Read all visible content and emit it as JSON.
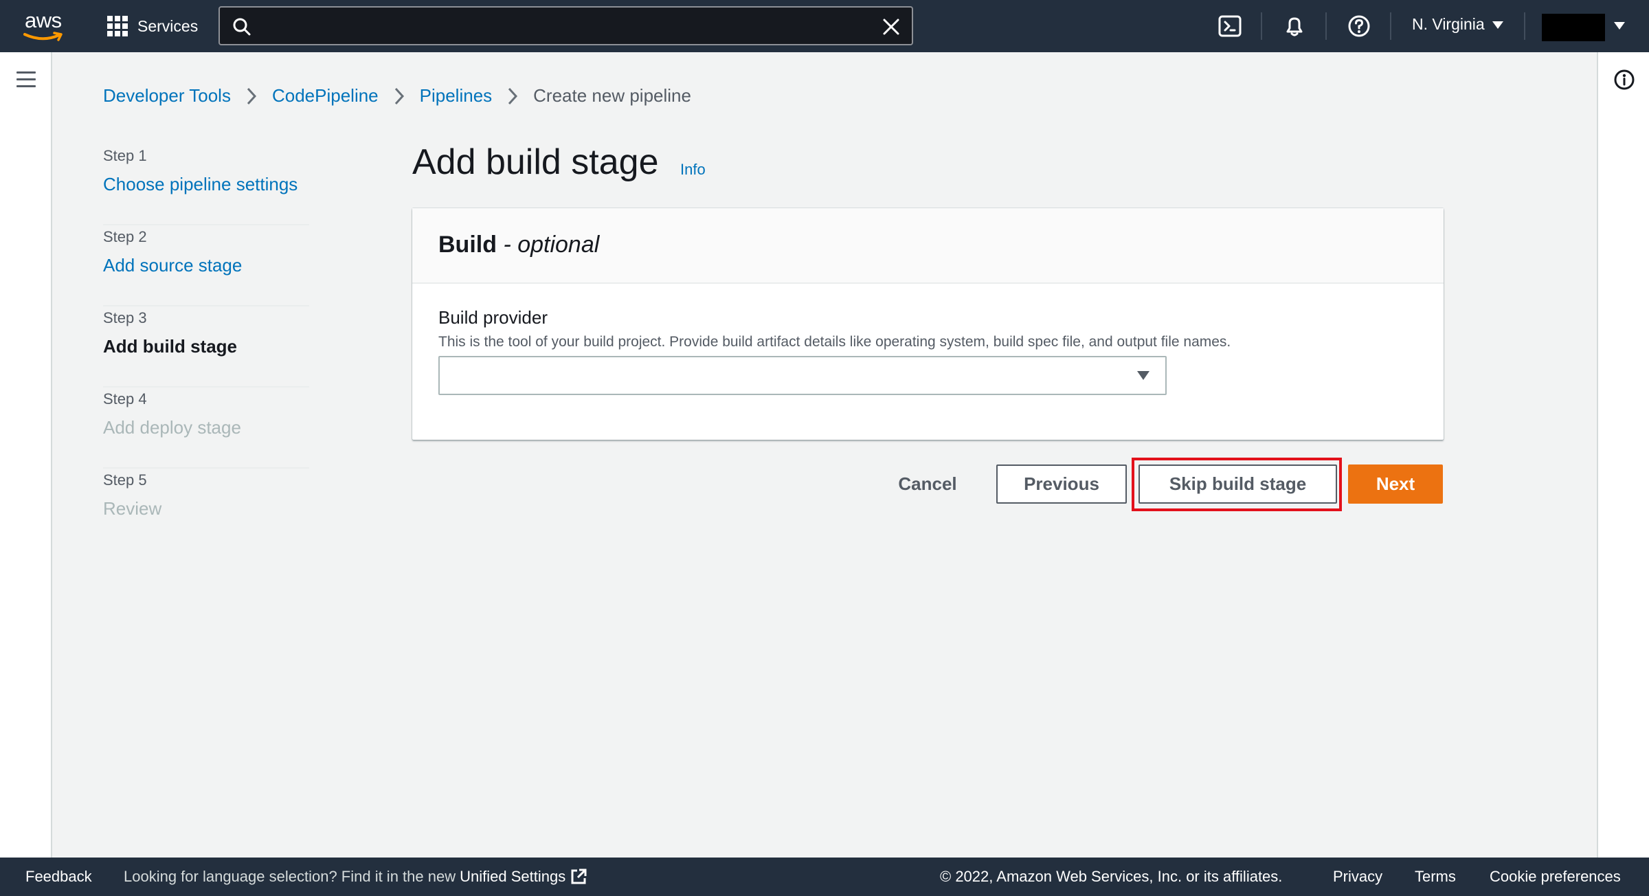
{
  "topnav": {
    "logo_text": "aws",
    "services_label": "Services",
    "search_value": "",
    "search_placeholder": "",
    "region": "N. Virginia"
  },
  "breadcrumb": [
    {
      "label": "Developer Tools"
    },
    {
      "label": "CodePipeline"
    },
    {
      "label": "Pipelines"
    },
    {
      "label": "Create new pipeline"
    }
  ],
  "steps": [
    {
      "num": "Step 1",
      "label": "Choose pipeline settings",
      "state": "link"
    },
    {
      "num": "Step 2",
      "label": "Add source stage",
      "state": "link"
    },
    {
      "num": "Step 3",
      "label": "Add build stage",
      "state": "active"
    },
    {
      "num": "Step 4",
      "label": "Add deploy stage",
      "state": "disabled"
    },
    {
      "num": "Step 5",
      "label": "Review",
      "state": "disabled"
    }
  ],
  "page": {
    "title": "Add build stage",
    "info": "Info"
  },
  "container": {
    "title": "Build",
    "optional": "- optional",
    "field_label": "Build provider",
    "field_description": "This is the tool of your build project. Provide build artifact details like operating system, build spec file, and output file names.",
    "selected_value": ""
  },
  "actions": {
    "cancel": "Cancel",
    "previous": "Previous",
    "skip": "Skip build stage",
    "next": "Next"
  },
  "footer": {
    "feedback": "Feedback",
    "language_text": "Looking for language selection? Find it in the new",
    "unified_settings": "Unified Settings",
    "copyright": "© 2022, Amazon Web Services, Inc. or its affiliates.",
    "privacy": "Privacy",
    "terms": "Terms",
    "cookie": "Cookie preferences"
  },
  "colors": {
    "nav_bg": "#232f3e",
    "link": "#0073bb",
    "primary": "#ec7211",
    "highlight": "#e3111b"
  }
}
